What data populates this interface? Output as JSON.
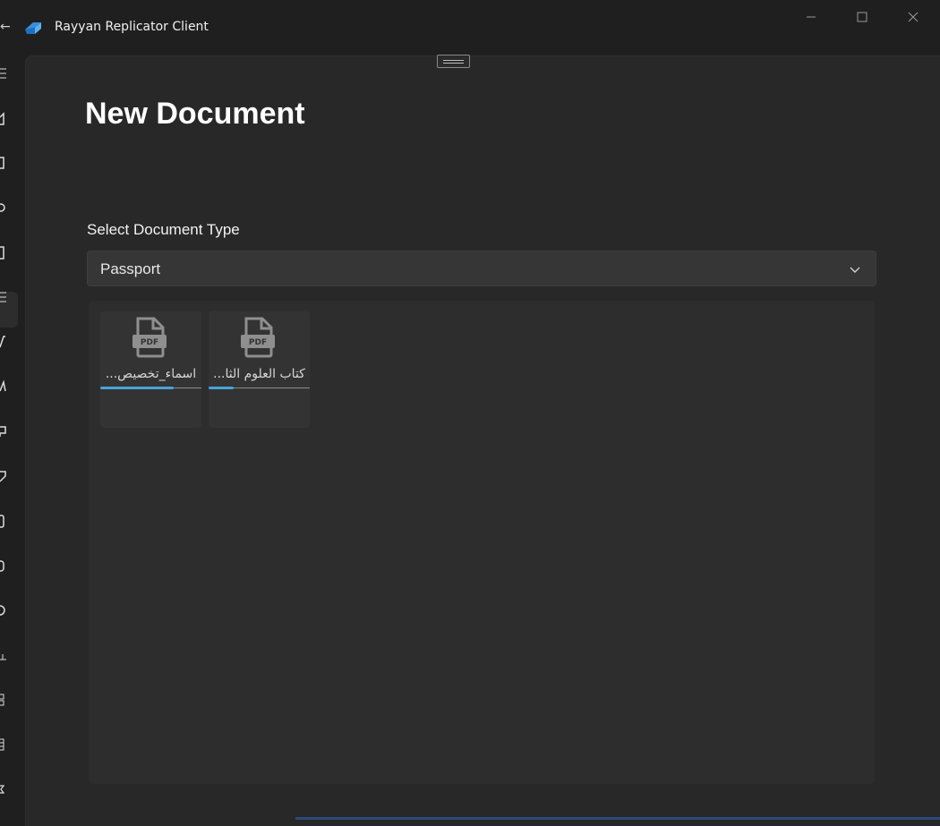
{
  "app": {
    "title": "Rayyan Replicator Client"
  },
  "nav": {
    "back_glyph": "←"
  },
  "rail": {
    "icons": [
      "menu-icon",
      "home-icon",
      "document-icon",
      "translate-icon",
      "clipboard-icon",
      "list-icon",
      "edit-icon",
      "text-icon",
      "chat-icon",
      "tag-icon",
      "bookmark-icon",
      "folder-icon",
      "info-icon",
      "chart-icon",
      "grid-icon",
      "table-icon",
      "settings-icon"
    ],
    "selected_index": 4
  },
  "main": {
    "title": "New Document",
    "document_type": {
      "label": "Select Document Type",
      "value": "Passport"
    }
  },
  "files": [
    {
      "name": "اسماء_تخصيص...",
      "progress": 0.73
    },
    {
      "name": "كتاب العلوم الثا...",
      "progress": 0.25
    }
  ],
  "colors": {
    "accent": "#4aa3d8",
    "background": "#1f1f1f",
    "surface": "#282828"
  }
}
